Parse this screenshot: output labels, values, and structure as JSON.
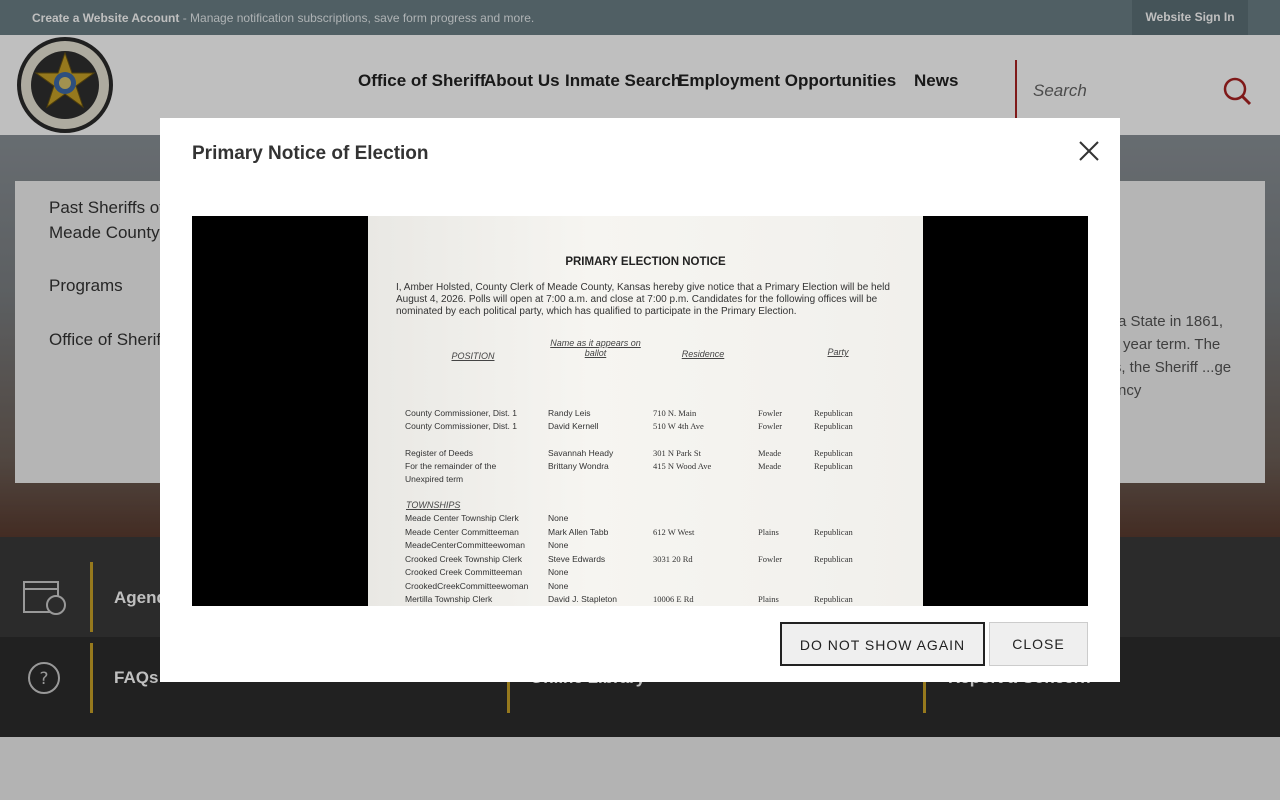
{
  "topbar": {
    "create_label": "Create a Website Account",
    "create_desc": " - Manage notification subscriptions, save form progress and more.",
    "signin_label": "Website Sign In"
  },
  "header": {
    "logo_alt": "Meade County Sheriff Kansas",
    "nav": [
      "Office of Sheriff",
      "About Us",
      "Inmate Search",
      "Employment Opportunities",
      "News"
    ],
    "search_placeholder": "Search"
  },
  "sidebar": {
    "items": [
      "Past Sheriffs of Meade County",
      "Programs",
      "Office of Sheriff"
    ]
  },
  "body_text": "...e a State in 1861, ...ur year term. The ...es, the Sheriff ...ge agency",
  "quick_links": [
    "Agendas & Minutes",
    "FAQs",
    "Online Library",
    "Report a Concern"
  ],
  "modal": {
    "title": "Primary Notice of Election",
    "dont_show_label": "DO NOT SHOW AGAIN",
    "close_label": "CLOSE",
    "document": {
      "heading": "PRIMARY ELECTION NOTICE",
      "paragraph": "I, Amber Holsted, County Clerk of Meade County, Kansas hereby give notice that a Primary Election will be held August 4, 2026. Polls will open at 7:00 a.m. and close at 7:00 p.m. Candidates for the following offices will be nominated by each political party, which has qualified to participate in the Primary Election.",
      "columns": [
        "POSITION",
        "Name as it appears on ballot",
        "Residence",
        "Party"
      ],
      "rows": [
        {
          "position": "County Commissioner, Dist. 1",
          "name": "Randy Leis",
          "residence": "710 N. Main",
          "town": "Fowler",
          "party": "Republican"
        },
        {
          "position": "County Commissioner, Dist. 1",
          "name": "David Kernell",
          "residence": "510 W 4th Ave",
          "town": "Fowler",
          "party": "Republican"
        },
        {
          "position": "Register of Deeds",
          "name": "Savannah Heady",
          "residence": "301 N Park St",
          "town": "Meade",
          "party": "Republican"
        },
        {
          "position": "For the remainder of the",
          "name": "Brittany Wondra",
          "residence": "415 N Wood Ave",
          "town": "Meade",
          "party": "Republican"
        },
        {
          "position": "Unexpired term",
          "name": "",
          "residence": "",
          "town": "",
          "party": ""
        }
      ],
      "townships_label": "TOWNSHIPS",
      "township_rows": [
        {
          "position": "Meade Center Township Clerk",
          "name": "None",
          "residence": "",
          "town": "",
          "party": ""
        },
        {
          "position": "Meade Center Committeeman",
          "name": "Mark Allen Tabb",
          "residence": "612 W West",
          "town": "Plains",
          "party": "Republican"
        },
        {
          "position": "MeadeCenterCommitteewoman",
          "name": "None",
          "residence": "",
          "town": "",
          "party": ""
        },
        {
          "position": "Crooked Creek Township Clerk",
          "name": "Steve Edwards",
          "residence": "3031 20 Rd",
          "town": "Fowler",
          "party": "Republican"
        },
        {
          "position": "Crooked Creek Committeeman",
          "name": "None",
          "residence": "",
          "town": "",
          "party": ""
        },
        {
          "position": "CrookedCreekCommitteewoman",
          "name": "None",
          "residence": "",
          "town": "",
          "party": ""
        },
        {
          "position": "Mertilla Township Clerk",
          "name": "David J. Stapleton",
          "residence": "10006 E Rd",
          "town": "Plains",
          "party": "Republican"
        }
      ]
    }
  },
  "colors": {
    "topbar": "#6b7f86",
    "accent_red": "#aa2222",
    "accent_gold": "#c9a227",
    "quicklinks_bg": "#3a3a3a"
  }
}
